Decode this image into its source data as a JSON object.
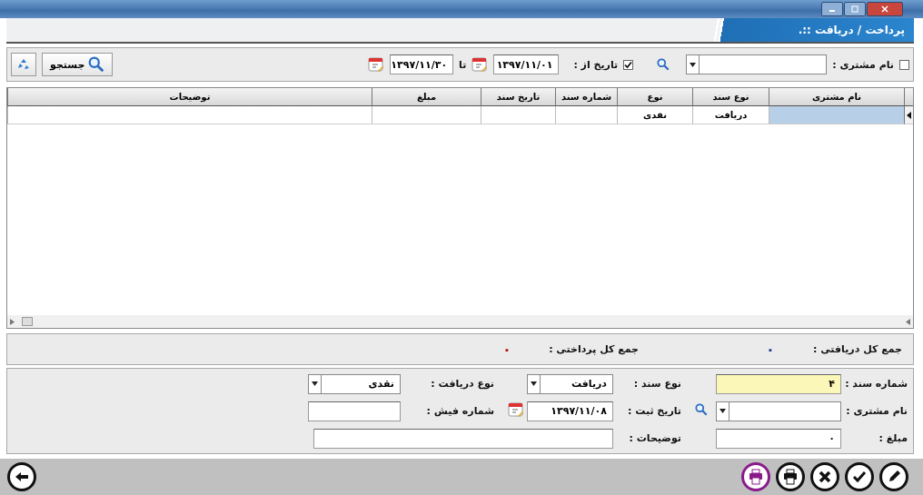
{
  "window": {
    "title": "پرداخت / دریافت ::."
  },
  "filter": {
    "customer": {
      "label": "نام مشتری :",
      "checked": false
    },
    "date": {
      "label": "تاریخ از :",
      "checked": true,
      "from": "۱۳۹۷/۱۱/۰۱",
      "to_label": "تا",
      "to": "۱۳۹۷/۱۱/۳۰"
    },
    "search_button": "جستجو"
  },
  "table": {
    "columns": [
      "نام مشتری",
      "نوع سند",
      "نوع",
      "شماره سند",
      "تاریخ سند",
      "مبلغ",
      "توضیحات"
    ],
    "rows": [
      {
        "selected": true,
        "cells": [
          "",
          "دریافت",
          "نقدی",
          "",
          "",
          "",
          ""
        ]
      }
    ]
  },
  "totals": [
    {
      "label": "جمع کل دریافتی :",
      "value": "۰",
      "color": "#1f3a8a"
    },
    {
      "label": "جمع کل پرداختی :",
      "value": "۰",
      "color": "#b01010"
    }
  ],
  "form": {
    "doc_number": {
      "label": "شماره سند :",
      "value": "۴",
      "focused": true
    },
    "doc_type": {
      "label": "نوع سند :",
      "value": "دریافت"
    },
    "receipt_type": {
      "label": "نوع دریافت :",
      "value": "نقدی"
    },
    "customer": {
      "label": "نام مشتری :"
    },
    "date": {
      "label": "تاریخ ثبت :",
      "value": "۱۳۹۷/۱۱/۰۸"
    },
    "slip_number": {
      "label": "شماره فیش :"
    },
    "amount": {
      "label": "مبلغ :",
      "value": "۰"
    },
    "description": {
      "label": "توضیحات :"
    }
  },
  "toolbar": [
    {
      "kind": "edit",
      "active": false
    },
    {
      "kind": "confirm",
      "active": false
    },
    {
      "kind": "cancel",
      "active": false
    },
    {
      "kind": "print",
      "active": false
    },
    {
      "kind": "print",
      "active": true
    }
  ],
  "back_button": {
    "kind": "back"
  }
}
